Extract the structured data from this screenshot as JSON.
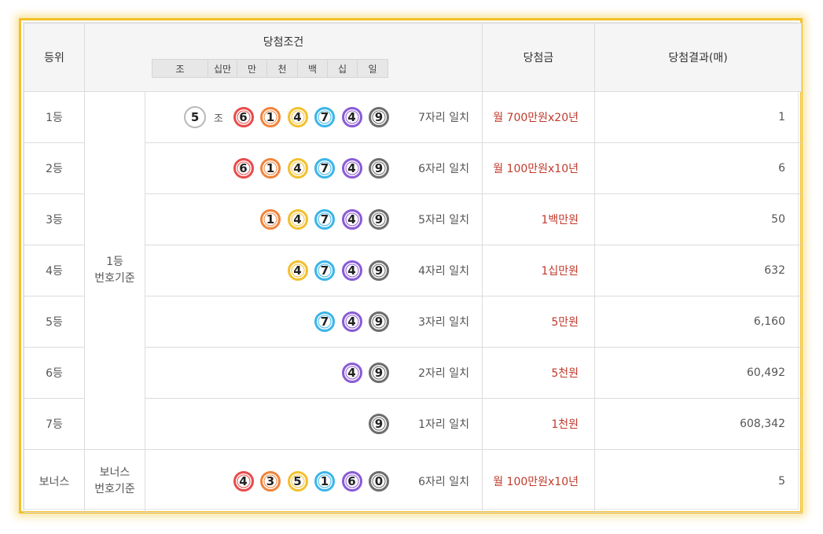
{
  "colors": {
    "frame_border": "#f3c02b",
    "amount_text": "#c0392b",
    "ball_gray_light": "#b8b8b8",
    "ball_red": "#e74c4c",
    "ball_orange": "#f0843c",
    "ball_yellow": "#f2c02f",
    "ball_blue": "#3db5e8",
    "ball_purple": "#8a5bd6",
    "ball_gray": "#6d6d6d"
  },
  "header": {
    "rank": "등위",
    "condition": "당첨조건",
    "amount": "당첨금",
    "result": "당첨결과(매)",
    "places": [
      "조",
      "십만",
      "만",
      "천",
      "백",
      "십",
      "일"
    ]
  },
  "basis": {
    "main_line1": "1등",
    "main_line2": "번호기준",
    "bonus_line1": "보너스",
    "bonus_line2": "번호기준"
  },
  "jo_label": "조",
  "rows": [
    {
      "rank": "1등",
      "jo": "5",
      "digits": [
        "6",
        "1",
        "4",
        "7",
        "4",
        "9"
      ],
      "match": "7자리 일치",
      "amount": "월 700만원x20년",
      "result": "1"
    },
    {
      "rank": "2등",
      "digits": [
        "6",
        "1",
        "4",
        "7",
        "4",
        "9"
      ],
      "match": "6자리 일치",
      "amount": "월 100만원x10년",
      "result": "6"
    },
    {
      "rank": "3등",
      "digits": [
        "1",
        "4",
        "7",
        "4",
        "9"
      ],
      "match": "5자리 일치",
      "amount": "1백만원",
      "result": "50"
    },
    {
      "rank": "4등",
      "digits": [
        "4",
        "7",
        "4",
        "9"
      ],
      "match": "4자리 일치",
      "amount": "1십만원",
      "result": "632"
    },
    {
      "rank": "5등",
      "digits": [
        "7",
        "4",
        "9"
      ],
      "match": "3자리 일치",
      "amount": "5만원",
      "result": "6,160"
    },
    {
      "rank": "6등",
      "digits": [
        "4",
        "9"
      ],
      "match": "2자리 일치",
      "amount": "5천원",
      "result": "60,492"
    },
    {
      "rank": "7등",
      "digits": [
        "9"
      ],
      "match": "1자리 일치",
      "amount": "1천원",
      "result": "608,342"
    }
  ],
  "bonus": {
    "rank": "보너스",
    "digits": [
      "4",
      "3",
      "5",
      "1",
      "6",
      "0"
    ],
    "match": "6자리 일치",
    "amount": "월 100만원x10년",
    "result": "5"
  }
}
